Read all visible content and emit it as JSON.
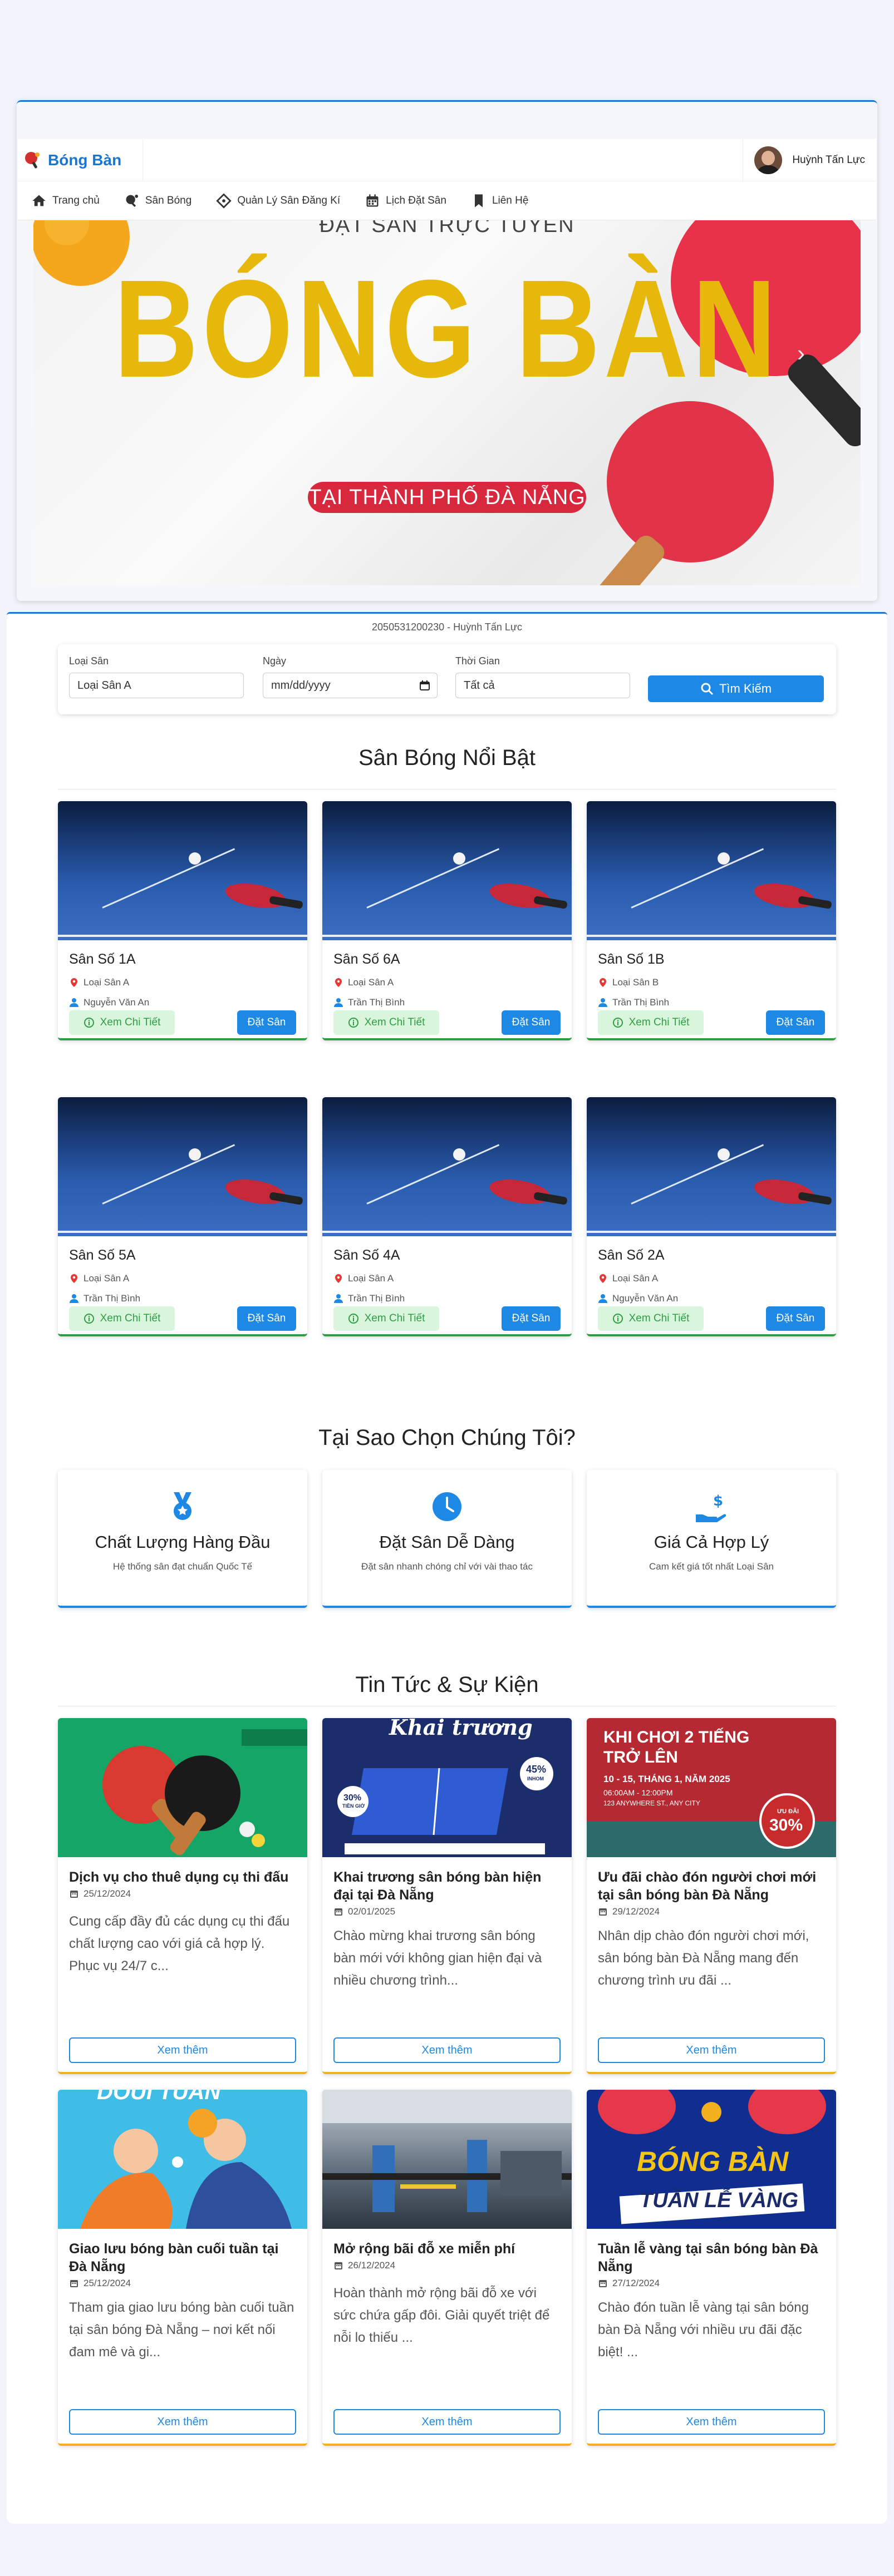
{
  "brand": {
    "name": "Bóng Bàn"
  },
  "user": {
    "name": "Huỳnh Tấn Lực"
  },
  "menu": [
    {
      "label": "Trang chủ",
      "icon": "home-icon"
    },
    {
      "label": "Sân Bóng",
      "icon": "ping-pong-icon"
    },
    {
      "label": "Quản Lý Sân Đăng Kí",
      "icon": "diamond-icon"
    },
    {
      "label": "Lịch Đặt Sân",
      "icon": "calendar-icon"
    },
    {
      "label": "Liên Hệ",
      "icon": "bookmark-icon"
    }
  ],
  "banner": {
    "subtitle": "ĐẶT SÂN TRỰC TUYẾN",
    "title": "BÓNG BÀN",
    "pill": "TẠI THÀNH PHỐ ĐÀ NẴNG",
    "next": "›"
  },
  "student": {
    "text": "2050531200230 - Huỳnh Tấn Lực"
  },
  "search": {
    "type_label": "Loại Sân",
    "type_value": "Loại Sân A",
    "date_label": "Ngày",
    "date_placeholder": "mm/dd/yyyy",
    "time_label": "Thời Gian",
    "time_value": "Tất cả",
    "button": "Tìm Kiếm"
  },
  "featured": {
    "title": "Sân Bóng Nổi Bật",
    "detail_label": "Xem Chi Tiết",
    "book_label": "Đặt Sân",
    "courts": [
      {
        "name": "Sân Số 1A",
        "type": "Loại Sân A",
        "owner": "Nguyễn Văn An"
      },
      {
        "name": "Sân Số 6A",
        "type": "Loại Sân A",
        "owner": "Trần Thị Bình"
      },
      {
        "name": "Sân Số 1B",
        "type": "Loại Sân B",
        "owner": "Trần Thị Bình"
      },
      {
        "name": "Sân Số 5A",
        "type": "Loại Sân A",
        "owner": "Trần Thị Bình"
      },
      {
        "name": "Sân Số 4A",
        "type": "Loại Sân A",
        "owner": "Trần Thị Bình"
      },
      {
        "name": "Sân Số 2A",
        "type": "Loại Sân A",
        "owner": "Nguyễn Văn An"
      }
    ]
  },
  "why": {
    "title": "Tại Sao Chọn Chúng Tôi?",
    "items": [
      {
        "title": "Chất Lượng Hàng Đầu",
        "desc": "Hệ thống sân đạt chuẩn Quốc Tế",
        "icon": "medal-icon"
      },
      {
        "title": "Đặt Sân Dễ Dàng",
        "desc": "Đặt sân nhanh chóng chỉ với vài thao tác",
        "icon": "clock-icon"
      },
      {
        "title": "Giá Cả Hợp Lý",
        "desc": "Cam kết giá tốt nhất Loại Sân",
        "icon": "hand-dollar-icon"
      }
    ]
  },
  "news": {
    "title": "Tin Tức & Sự Kiện",
    "more_label": "Xem thêm",
    "items": [
      {
        "title": "Dịch vụ cho thuê dụng cụ thi đấu",
        "date": "25/12/2024",
        "excerpt": "Cung cấp đầy đủ các dụng cụ thi đấu chất lượng cao với giá cả hợp lý. Phục vụ 24/7 c..."
      },
      {
        "title": "Khai trương sân bóng bàn hiện đại tại Đà Nẵng",
        "date": "02/01/2025",
        "excerpt": "Chào mừng khai trương sân bóng bàn mới với không gian hiện đại và nhiều chương trình..."
      },
      {
        "title": "Ưu đãi chào đón người chơi mới tại sân bóng bàn Đà Nẵng",
        "date": "29/12/2024",
        "excerpt": "Nhân dịp chào đón người chơi mới, sân bóng bàn Đà Nẵng mang đến chương trình ưu đãi ..."
      },
      {
        "title": "Giao lưu bóng bàn cuối tuần tại Đà Nẵng",
        "date": "25/12/2024",
        "excerpt": "Tham gia giao lưu bóng bàn cuối tuần tại sân bóng Đà Nẵng – nơi kết nối đam mê và gi..."
      },
      {
        "title": "Mở rộng bãi đỗ xe miễn phí",
        "date": "26/12/2024",
        "excerpt": "Hoàn thành mở rộng bãi đỗ xe với sức chứa gấp đôi. Giải quyết triệt để nỗi lo thiếu ..."
      },
      {
        "title": "Tuần lễ vàng tại sân bóng bàn Đà Nẵng",
        "date": "27/12/2024",
        "excerpt": "Chào đón tuần lễ vàng tại sân bóng bàn Đà Nẵng với nhiều ưu đãi đặc biệt! ..."
      }
    ],
    "image_text": {
      "n2_title": "Khai trương",
      "n2_badge1": "30%",
      "n2_badge1_sub": "TIỀN GIỜ",
      "n2_badge2": "45%",
      "n2_badge2_sub": "INHOM",
      "n3_line1": "KHI CHƠI 2 TIẾNG",
      "n3_line2": "TRỞ LÊN",
      "n3_line3": "10 - 15, THÁNG 1, NĂM 2025",
      "n3_line4": "06:00AM - 12:00PM",
      "n3_line5": "123 ANYWHERE ST., ANY CITY",
      "n3_badge_top": "ƯU ĐÃI",
      "n3_badge": "30%",
      "n4_text": "DOUI TUAN",
      "n6_line1": "BÓNG BÀN",
      "n6_line2": "TUẦN LỄ VÀNG"
    }
  },
  "colors": {
    "primary": "#1e88e5",
    "success": "#2e9e44",
    "accent": "#f2b01e",
    "banner_gold": "#e6b80c",
    "banner_red": "#d8283d"
  }
}
